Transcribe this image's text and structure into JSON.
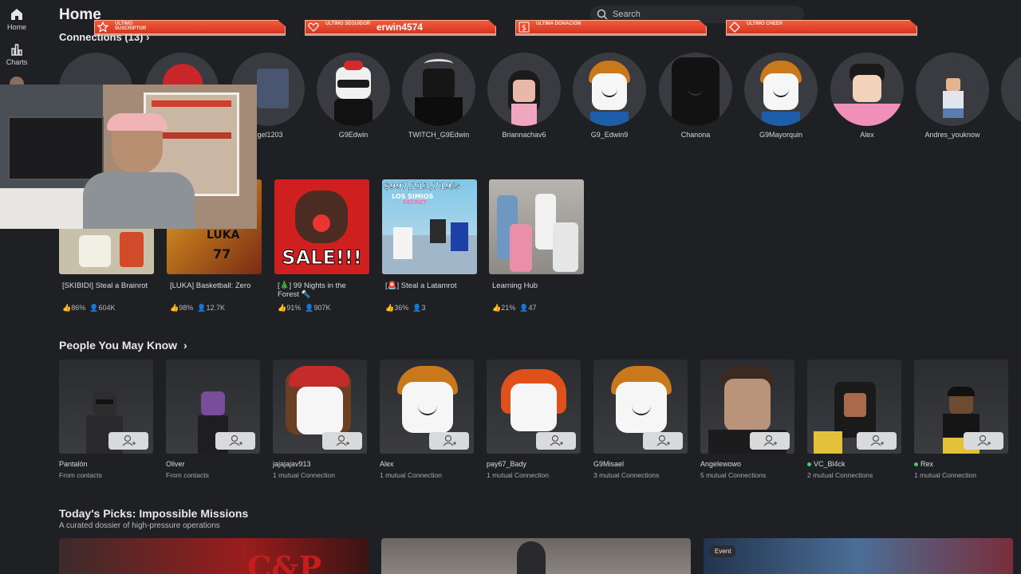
{
  "sidebar": {
    "items": [
      {
        "label": "Home",
        "icon": "home-icon"
      },
      {
        "label": "Charts",
        "icon": "charts-icon"
      }
    ]
  },
  "header": {
    "title": "Home",
    "search_placeholder": "Search"
  },
  "banners": [
    {
      "label": "ULTIMO SUSCRIPTOR",
      "value": "",
      "icon": "star-icon"
    },
    {
      "label": "ULTIMO SEGUIDOR",
      "value": "erwin4574",
      "icon": "heart-icon"
    },
    {
      "label": "ULTIMA DONACION",
      "value": "",
      "icon": "dollar-icon"
    },
    {
      "label": "ULTIMO CHEER",
      "value": "",
      "icon": "diamond-icon"
    }
  ],
  "connections": {
    "title": "Connections (13)",
    "items": [
      {
        "name": ""
      },
      {
        "name": ""
      },
      {
        "name": "ngel1203"
      },
      {
        "name": "G9Edwin"
      },
      {
        "name": "TWITCH_G9Edwin"
      },
      {
        "name": "Briannachav6"
      },
      {
        "name": "G9_Edwin9"
      },
      {
        "name": "Chanona"
      },
      {
        "name": "G9Mayorquin"
      },
      {
        "name": "Alex"
      },
      {
        "name": "Andres_youknow"
      }
    ]
  },
  "games": [
    {
      "title": "[SKIBIDI] Steal a Brainrot",
      "rating": "86%",
      "players": "604K"
    },
    {
      "title": "[LUKA] Basketball: Zero",
      "rating": "98%",
      "players": "12.7K"
    },
    {
      "title": "[🎄] 99 Nights in the Forest 🔦",
      "rating": "91%",
      "players": "907K"
    },
    {
      "title": "[🚨] Steal a Latamrot",
      "rating": "36%",
      "players": "3"
    },
    {
      "title": "Learning Hub",
      "rating": "21%",
      "players": "47"
    }
  ],
  "game_thumbs": {
    "sale_text": "SALE!!!",
    "money_text": "$997,213,719/s",
    "los_simios_text": "LOS SIMIOS",
    "secret_text": "SECRET",
    "luka_text": "LUKA",
    "luka_num": "77"
  },
  "people": {
    "title": "People You May Know",
    "items": [
      {
        "name": "Pantalón",
        "sub": "From contacts",
        "online": false
      },
      {
        "name": "Oliver",
        "sub": "From contacts",
        "online": false
      },
      {
        "name": "jajajajav913",
        "sub": "1 mutual Connection",
        "online": false
      },
      {
        "name": "Alex",
        "sub": "1 mutual Connection",
        "online": false
      },
      {
        "name": "pay67_Bady",
        "sub": "1 mutual Connection",
        "online": false
      },
      {
        "name": "G9Misael",
        "sub": "3 mutual Connections",
        "online": false
      },
      {
        "name": "Angelewowo",
        "sub": "5 mutual Connections",
        "online": false
      },
      {
        "name": "VC_Bl4ck",
        "sub": "2 mutual Connections",
        "online": true
      },
      {
        "name": "Rex",
        "sub": "1 mutual Connection",
        "online": true
      }
    ]
  },
  "picks": {
    "title": "Today's Picks: Impossible Missions",
    "subtitle": "A curated dossier of high-pressure operations",
    "event_badge": "Event",
    "first_thumb_text": "C&P"
  },
  "colors": {
    "background": "#1f2024",
    "banner_red": "#e0412a",
    "online_green": "#3ccf6e"
  }
}
